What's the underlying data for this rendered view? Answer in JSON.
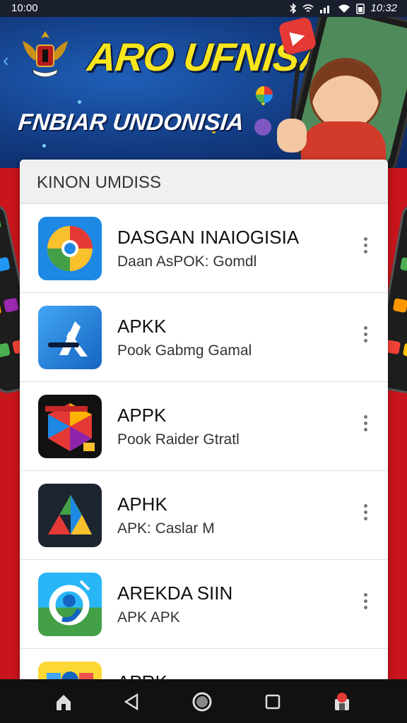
{
  "status_bar": {
    "time": "10:00",
    "right_time": "10:32"
  },
  "banner": {
    "headline": "ARO UFNISA",
    "subhead": "FNBIAR UNDONISIA"
  },
  "list": {
    "header": "KINON UMDISS",
    "items": [
      {
        "title": "DASGAN INAIOGISIA",
        "subtitle": "Daan AsPOK: Gomdl",
        "icon": "chrome-style-icon"
      },
      {
        "title": "APKK",
        "subtitle": "Pook Gabmg Gamal",
        "icon": "app-store-a-icon"
      },
      {
        "title": "APPK",
        "subtitle": "Pook Raider Gtratl",
        "icon": "colorful-game-icon"
      },
      {
        "title": "APHK",
        "subtitle": "APK: Caslar M",
        "icon": "drive-triangle-icon"
      },
      {
        "title": "AREKDA SIIN",
        "subtitle": "APK APK",
        "icon": "swirl-app-icon"
      },
      {
        "title": "APRK",
        "subtitle": "",
        "icon": "yellow-app-icon"
      }
    ]
  },
  "navbar": {
    "buttons": [
      "home-icon",
      "back-icon",
      "circle-home-icon",
      "recents-icon",
      "store-icon"
    ]
  },
  "colors": {
    "banner_blue": "#123a80",
    "headline_yellow": "#f7e51e",
    "background_red": "#c8141a"
  }
}
